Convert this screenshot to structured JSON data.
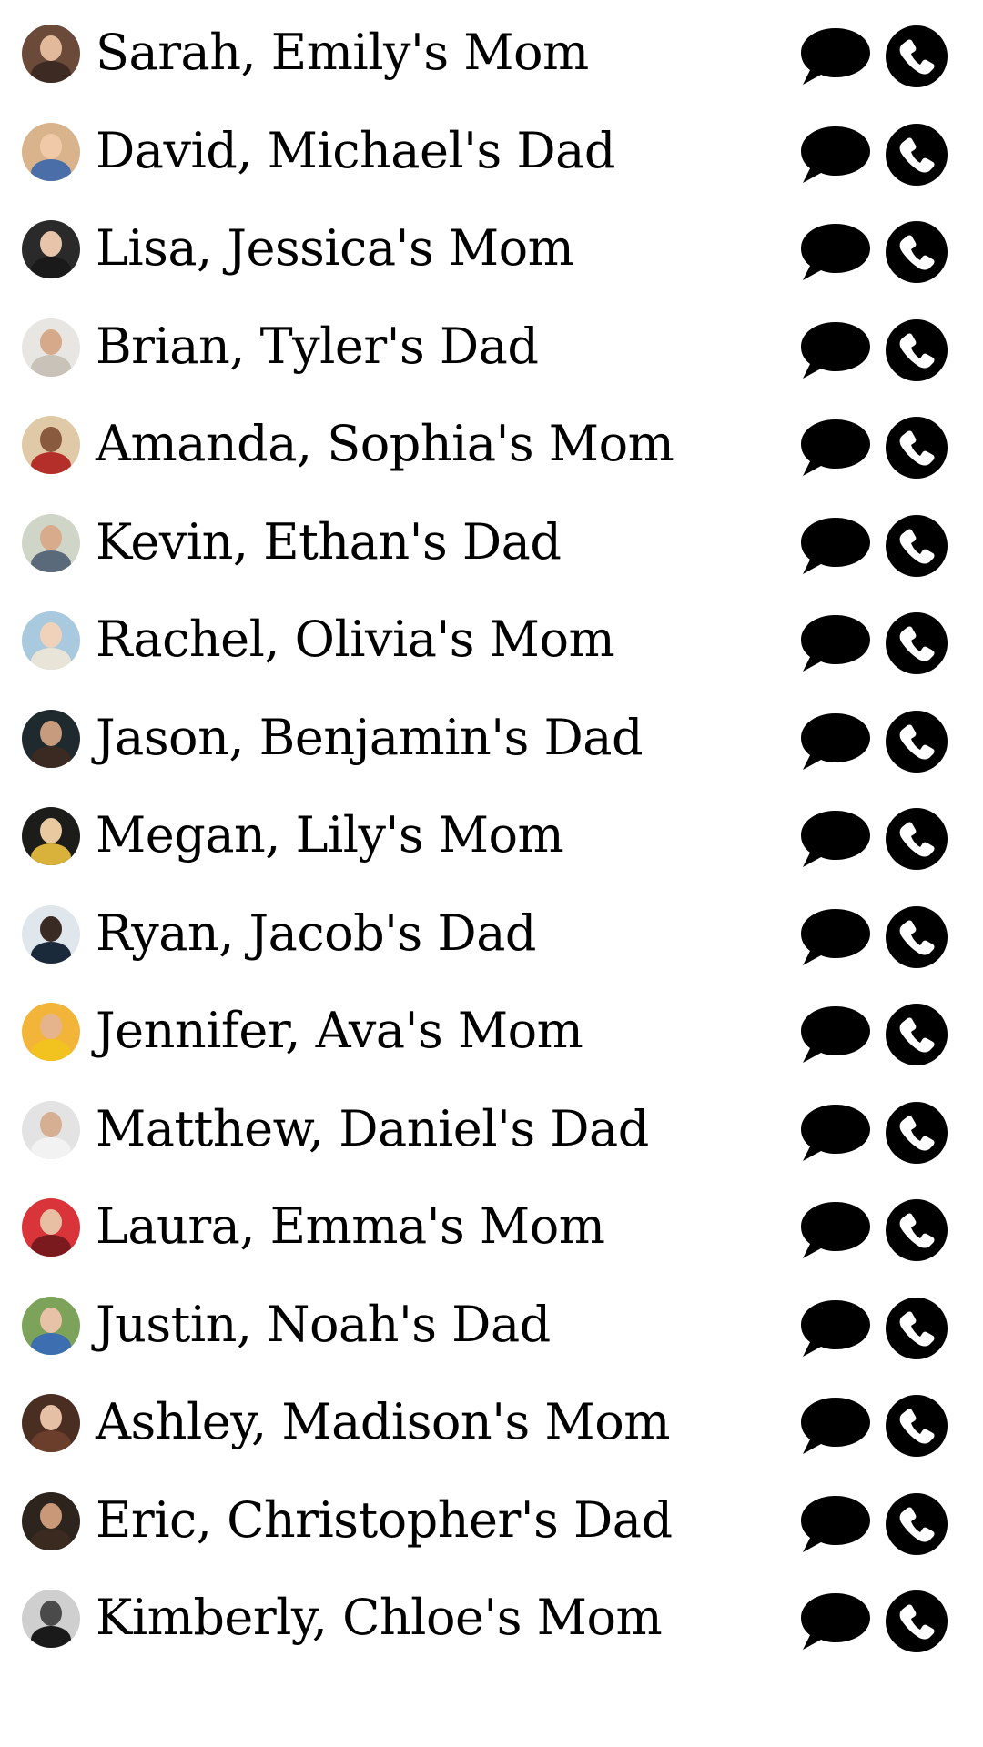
{
  "contacts": [
    {
      "name": "Sarah, Emily's Mom",
      "avatar": {
        "bg": "#6b4a3a",
        "face": "#e2b99a",
        "body": "#3d2a22"
      }
    },
    {
      "name": "David, Michael's Dad",
      "avatar": {
        "bg": "#d9b38c",
        "face": "#f0c9a8",
        "body": "#4a6ea8"
      }
    },
    {
      "name": "Lisa, Jessica's Mom",
      "avatar": {
        "bg": "#2a2a2a",
        "face": "#e8c4aa",
        "body": "#1a1a1a"
      }
    },
    {
      "name": "Brian, Tyler's Dad",
      "avatar": {
        "bg": "#e8e6e2",
        "face": "#d6a98a",
        "body": "#c9c2b8"
      }
    },
    {
      "name": "Amanda, Sophia's Mom",
      "avatar": {
        "bg": "#e0c9a6",
        "face": "#8a5a3e",
        "body": "#b52f2a"
      }
    },
    {
      "name": "Kevin, Ethan's Dad",
      "avatar": {
        "bg": "#cfd6c8",
        "face": "#d8ab8c",
        "body": "#5a6a7a"
      }
    },
    {
      "name": "Rachel, Olivia's Mom",
      "avatar": {
        "bg": "#a9c9df",
        "face": "#f0d2bb",
        "body": "#e9e4d8"
      }
    },
    {
      "name": "Jason, Benjamin's Dad",
      "avatar": {
        "bg": "#1f2a2e",
        "face": "#c79b7e",
        "body": "#3a2a22"
      }
    },
    {
      "name": "Megan, Lily's Mom",
      "avatar": {
        "bg": "#1c1c1a",
        "face": "#e8c9a0",
        "body": "#d8b23a"
      }
    },
    {
      "name": "Ryan, Jacob's Dad",
      "avatar": {
        "bg": "#dfe6ec",
        "face": "#3a2a24",
        "body": "#1a2a3a"
      }
    },
    {
      "name": "Jennifer, Ava's Mom",
      "avatar": {
        "bg": "#f3b43a",
        "face": "#e6b48c",
        "body": "#f2c21e"
      }
    },
    {
      "name": "Matthew, Daniel's Dad",
      "avatar": {
        "bg": "#e3e3e3",
        "face": "#d6ae92",
        "body": "#f2f2f2"
      }
    },
    {
      "name": "Laura, Emma's Mom",
      "avatar": {
        "bg": "#d8343a",
        "face": "#e8bfa2",
        "body": "#7a1a1e"
      }
    },
    {
      "name": "Justin, Noah's Dad",
      "avatar": {
        "bg": "#7da25a",
        "face": "#e8c2a6",
        "body": "#3d6fb0"
      }
    },
    {
      "name": "Ashley, Madison's Mom",
      "avatar": {
        "bg": "#4a2e22",
        "face": "#e6c0a4",
        "body": "#6a3e2a"
      }
    },
    {
      "name": "Eric, Christopher's Dad",
      "avatar": {
        "bg": "#2e241e",
        "face": "#c89878",
        "body": "#3a2a20"
      }
    },
    {
      "name": "Kimberly, Chloe's Mom",
      "avatar": {
        "bg": "#cfcfcf",
        "face": "#4a4a4a",
        "body": "#1a1a1a"
      }
    }
  ],
  "icons": {
    "message": "speech-bubble-icon",
    "call": "phone-icon",
    "color": "#000000"
  }
}
